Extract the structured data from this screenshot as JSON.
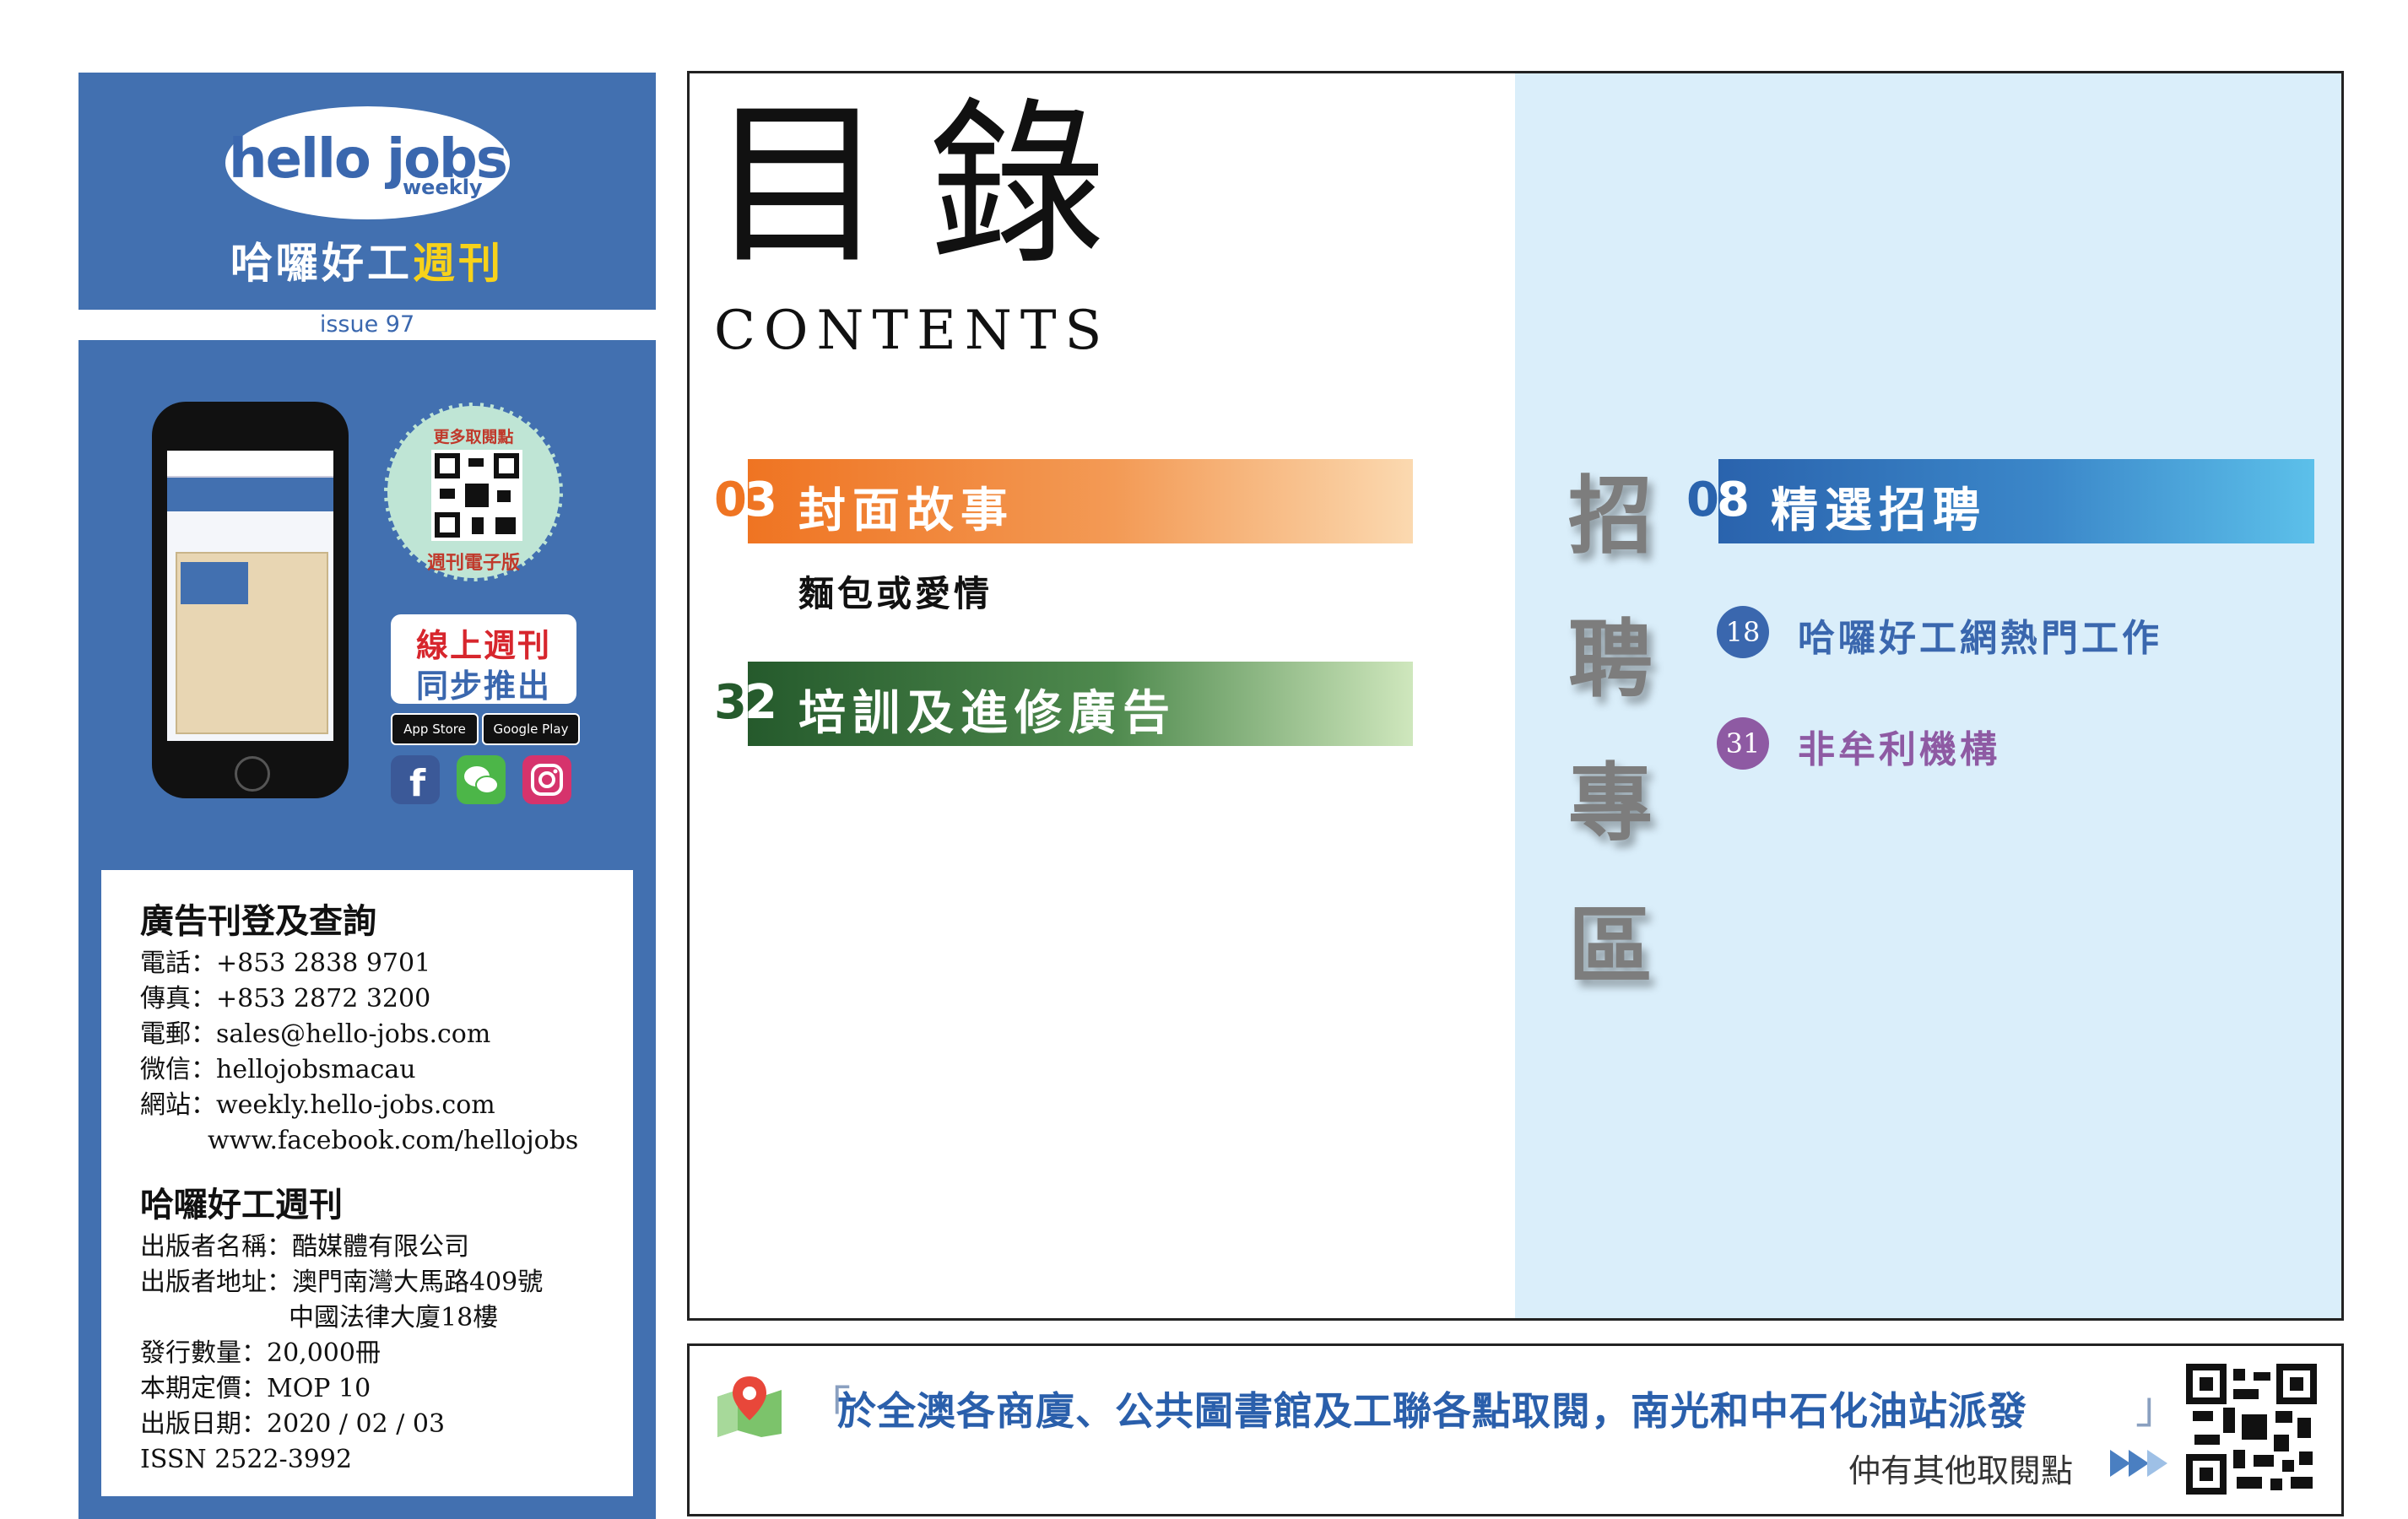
{
  "sidebar": {
    "logo": {
      "name": "hello jobs",
      "sub": "weekly",
      "cn_white": "哈囉好工",
      "cn_yellow": "週刊"
    },
    "issue": "issue 97",
    "qr_badge": {
      "top": "更多取閱點",
      "bottom": "週刊電子版"
    },
    "online": {
      "line1": "線上週刊",
      "line2": "同步推出"
    },
    "stores": {
      "apple": "App Store",
      "google": "Google Play"
    },
    "social_icons": [
      "facebook-icon",
      "wechat-icon",
      "instagram-icon"
    ],
    "ad_section": {
      "heading": "廣告刊登及查詢",
      "lines": [
        "電話：+853 2838 9701",
        "傳真：+853 2872 3200",
        "電郵：sales@hello-jobs.com",
        "微信：hellojobsmacau",
        "網站：weekly.hello-jobs.com",
        "www.facebook.com/hellojobs"
      ]
    },
    "pub_section": {
      "heading": "哈囉好工週刊",
      "lines": [
        "出版者名稱：酷媒體有限公司",
        "出版者地址：澳門南灣大馬路409號",
        "中國法律大廈18樓",
        "發行數量：20,000冊",
        "本期定價：MOP 10",
        "出版日期：2020 / 02 / 03",
        "ISSN 2522-3992"
      ]
    }
  },
  "main": {
    "title_cn": "目錄",
    "title_en": "CONTENTS",
    "sections": [
      {
        "num_a": "0",
        "num_b": "3",
        "label": "封面故事",
        "sub": "麵包或愛情"
      },
      {
        "num_a": "3",
        "num_b": "2",
        "label": "培訓及進修廣告"
      }
    ],
    "recruit": {
      "vertical": [
        "招",
        "聘",
        "專",
        "區"
      ],
      "header": {
        "num_a": "0",
        "num_b": "8",
        "label": "精選招聘"
      },
      "items": [
        {
          "num": "18",
          "label": "哈囉好工網熱門工作"
        },
        {
          "num": "31",
          "label": "非牟利機構"
        }
      ]
    }
  },
  "banner": {
    "bracket_open": "「",
    "bracket_close": "」",
    "notice": "於全澳各商廈、公共圖書館及工聯各點取閱，南光和中石化油站派發",
    "more": "仲有其他取閱點"
  },
  "colors": {
    "brand_blue": "#4270b0",
    "orange": "#f07a2a",
    "green": "#2a5e2e",
    "blue_bar": "#3a67ae",
    "purple": "#8e5aa3",
    "recruit_bg": "#daeefa"
  }
}
